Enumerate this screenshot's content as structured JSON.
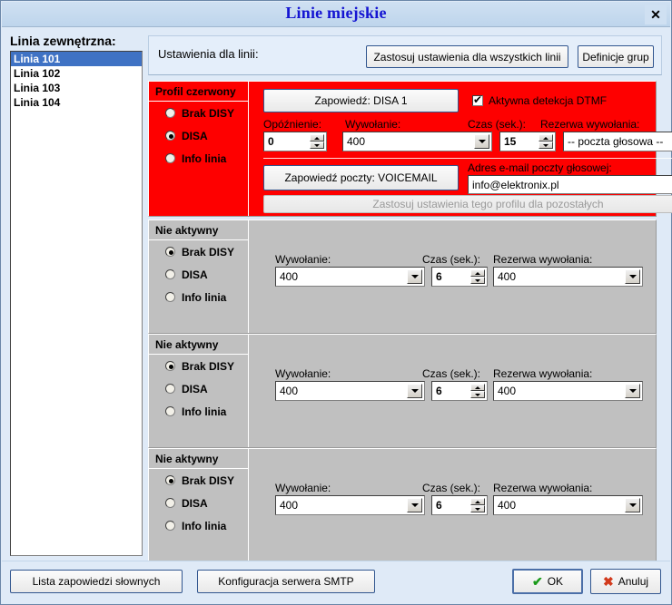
{
  "window": {
    "title": "Linie miejskie",
    "close_label": "✕"
  },
  "sidebar": {
    "label": "Linia zewnętrzna:",
    "items": [
      {
        "label": "Linia 101",
        "selected": true
      },
      {
        "label": "Linia 102",
        "selected": false
      },
      {
        "label": "Linia 103",
        "selected": false
      },
      {
        "label": "Linia 104",
        "selected": false
      }
    ]
  },
  "top_strip": {
    "label": "Ustawienia dla linii:",
    "apply_all_label": "Zastosuj ustawienia dla wszystkich linii",
    "group_definitions_label": "Definicje grup"
  },
  "profiles": [
    {
      "title": "Profil czerwony",
      "state": "red",
      "radios": [
        {
          "label": "Brak DISY",
          "selected": false
        },
        {
          "label": "DISA",
          "selected": true
        },
        {
          "label": "Info linia",
          "selected": false
        }
      ],
      "announcement_button": "Zapowiedź: DISA 1",
      "dtmf_label": "Aktywna detekcja DTMF",
      "dtmf_checked": true,
      "delay_label": "Opóźnienie:",
      "delay_value": "0",
      "ring_label": "Wywołanie:",
      "ring_value": "400",
      "time_label": "Czas (sek.):",
      "time_value": "15",
      "reserve_label": "Rezerwa wywołania:",
      "reserve_value": "-- poczta głosowa --",
      "voicemail_button": "Zapowiedź poczty: VOICEMAIL",
      "email_label": "Adres e-mail poczty głosowej:",
      "email_value": "info@elektronix.pl",
      "apply_profile_label": "Zastosuj ustawienia tego profilu dla pozostałych"
    },
    {
      "title": "Nie aktywny",
      "state": "gray",
      "radios": [
        {
          "label": "Brak DISY",
          "selected": true
        },
        {
          "label": "DISA",
          "selected": false
        },
        {
          "label": "Info linia",
          "selected": false
        }
      ],
      "ring_label": "Wywołanie:",
      "ring_value": "400",
      "time_label": "Czas (sek.):",
      "time_value": "6",
      "reserve_label": "Rezerwa wywołania:",
      "reserve_value": "400"
    },
    {
      "title": "Nie aktywny",
      "state": "gray",
      "radios": [
        {
          "label": "Brak DISY",
          "selected": true
        },
        {
          "label": "DISA",
          "selected": false
        },
        {
          "label": "Info linia",
          "selected": false
        }
      ],
      "ring_label": "Wywołanie:",
      "ring_value": "400",
      "time_label": "Czas (sek.):",
      "time_value": "6",
      "reserve_label": "Rezerwa wywołania:",
      "reserve_value": "400"
    },
    {
      "title": "Nie aktywny",
      "state": "gray",
      "radios": [
        {
          "label": "Brak DISY",
          "selected": true
        },
        {
          "label": "DISA",
          "selected": false
        },
        {
          "label": "Info linia",
          "selected": false
        }
      ],
      "ring_label": "Wywołanie:",
      "ring_value": "400",
      "time_label": "Czas (sek.):",
      "time_value": "6",
      "reserve_label": "Rezerwa wywołania:",
      "reserve_value": "400"
    }
  ],
  "footer": {
    "word_list_label": "Lista zapowiedzi słownych",
    "smtp_config_label": "Konfiguracja serwera SMTP",
    "ok_label": "OK",
    "cancel_label": "Anuluj"
  },
  "colors": {
    "active_profile": "#fe0000",
    "inactive_profile": "#c0c0c0",
    "title_text": "#1414d2",
    "selection": "#3f72c4",
    "window_bg": "#dfeaf7"
  }
}
